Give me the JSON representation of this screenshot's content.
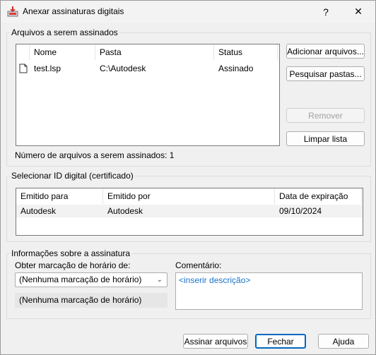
{
  "window": {
    "title": "Anexar assinaturas digitais",
    "help_glyph": "?",
    "close_glyph": "✕"
  },
  "files_group": {
    "label": "Arquivos a serem assinados",
    "columns": [
      "Nome",
      "Pasta",
      "Status"
    ],
    "rows": [
      {
        "name": "test.lsp",
        "folder": "C:\\Autodesk",
        "status": "Assinado"
      }
    ],
    "count_text": "Número de arquivos a serem assinados: 1",
    "add_button": "Adicionar arquivos...",
    "search_button": "Pesquisar pastas...",
    "remove_button": "Remover",
    "clear_button": "Limpar lista"
  },
  "cert_group": {
    "label": "Selecionar ID digital (certificado)",
    "columns": [
      "Emitido para",
      "Emitido por",
      "Data de expiração"
    ],
    "rows": [
      {
        "issued_to": "Autodesk",
        "issued_by": "Autodesk",
        "expires": "09/10/2024"
      }
    ]
  },
  "info_group": {
    "label": "Informações sobre a assinatura",
    "timestamp_label": "Obter marcação de horário de:",
    "timestamp_value": "(Nenhuma marcação de horário)",
    "timestamp_readonly": "(Nenhuma marcação de horário)",
    "comment_label": "Comentário:",
    "comment_placeholder": "<inserir descrição>"
  },
  "footer": {
    "sign_button": "Assinar arquivos",
    "close_button": "Fechar",
    "help_button": "Ajuda"
  }
}
